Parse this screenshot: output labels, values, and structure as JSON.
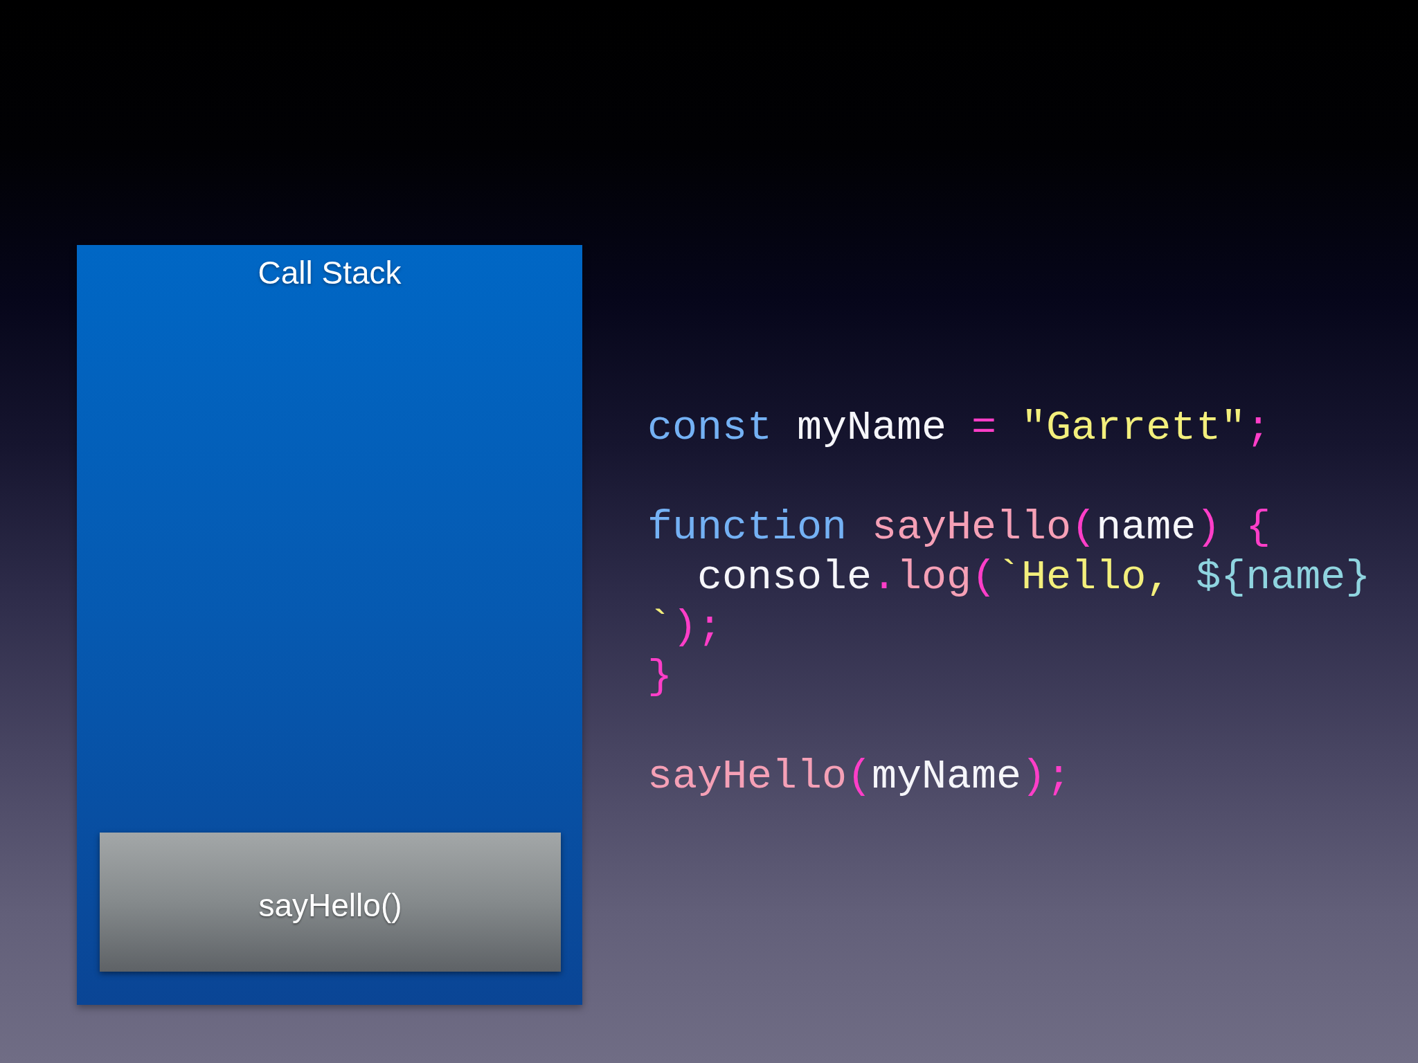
{
  "call_stack": {
    "title": "Call Stack",
    "frames": [
      {
        "label": "sayHello()"
      }
    ]
  },
  "code": {
    "blocks": [
      {
        "lines": [
          {
            "tokens": [
              {
                "text": "const ",
                "kind": "keyword"
              },
              {
                "text": "myName ",
                "kind": "identifier"
              },
              {
                "text": "= ",
                "kind": "punctuation"
              },
              {
                "text": "\"Garrett\"",
                "kind": "string"
              },
              {
                "text": ";",
                "kind": "punctuation"
              }
            ]
          }
        ]
      },
      {
        "lines": [
          {
            "tokens": [
              {
                "text": "function ",
                "kind": "keyword"
              },
              {
                "text": "sayHello",
                "kind": "function"
              },
              {
                "text": "(",
                "kind": "punctuation"
              },
              {
                "text": "name",
                "kind": "identifier"
              },
              {
                "text": ") {",
                "kind": "punctuation"
              }
            ],
            "children": [
              {
                "tokens": [
                  {
                    "text": "console",
                    "kind": "identifier"
                  },
                  {
                    "text": ".",
                    "kind": "punctuation"
                  },
                  {
                    "text": "log",
                    "kind": "function"
                  },
                  {
                    "text": "(",
                    "kind": "punctuation"
                  },
                  {
                    "text": "`Hello, ",
                    "kind": "string"
                  },
                  {
                    "text": "${name}",
                    "kind": "interpolation"
                  }
                ]
              }
            ]
          },
          {
            "tokens": [
              {
                "text": "`",
                "kind": "string"
              },
              {
                "text": ");",
                "kind": "punctuation"
              }
            ]
          },
          {
            "tokens": [
              {
                "text": "}",
                "kind": "punctuation"
              }
            ]
          }
        ]
      },
      {
        "lines": [
          {
            "tokens": [
              {
                "text": "sayHello",
                "kind": "function"
              },
              {
                "text": "(",
                "kind": "punctuation"
              },
              {
                "text": "myName",
                "kind": "identifier"
              },
              {
                "text": ");",
                "kind": "punctuation"
              }
            ]
          }
        ]
      }
    ]
  }
}
